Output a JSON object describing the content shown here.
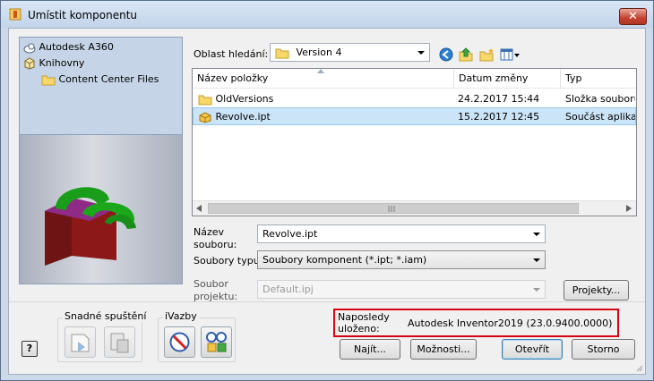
{
  "window": {
    "title": "Umístit komponentu",
    "close": "✕"
  },
  "locations": [
    {
      "label": "Autodesk A360",
      "icon": "a360-icon"
    },
    {
      "label": "Knihovny",
      "icon": "libraries-icon"
    },
    {
      "label": "Content Center Files",
      "icon": "folder-icon"
    }
  ],
  "search": {
    "label": "Oblast hledání:",
    "value": "Version 4"
  },
  "list": {
    "columns": [
      "Název položky",
      "Datum změny",
      "Typ"
    ],
    "rows": [
      {
        "name": "OldVersions",
        "date": "24.2.2017 15:44",
        "type": "Složka souborů",
        "icon": "folder-icon",
        "selected": false
      },
      {
        "name": "Revolve.ipt",
        "date": "15.2.2017 12:45",
        "type": "Součást aplikac",
        "icon": "part-icon",
        "selected": true
      }
    ]
  },
  "fields": {
    "filename_label": "Název\nsouboru:",
    "filename_label_l1": "Název",
    "filename_label_l2": "souboru:",
    "filename_value": "Revolve.ipt",
    "filetype_label": "Soubory typu:",
    "filetype_value": "Soubory komponent (*.ipt; *.iam)",
    "project_label_l1": "Soubor",
    "project_label_l2": "projektu:",
    "project_value": "Default.ipj",
    "projects_button": "Projekty..."
  },
  "quick_launch": {
    "label": "Snadné spuštění"
  },
  "imates": {
    "label": "iVazby"
  },
  "saved": {
    "label_l1": "Naposledy",
    "label_l2": "uloženo:",
    "value": "Autodesk Inventor2019 (23.0.9400.0000)"
  },
  "buttons": {
    "find": "Najít...",
    "options": "Možnosti...",
    "open": "Otevřít",
    "cancel": "Storno"
  },
  "help": "?"
}
